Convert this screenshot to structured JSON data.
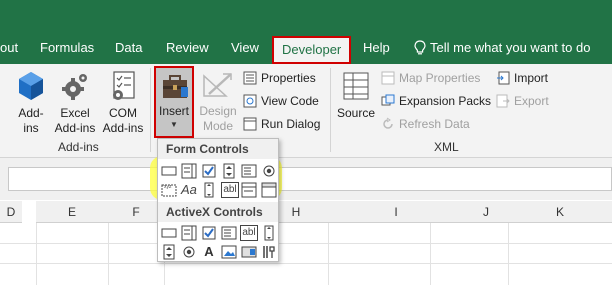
{
  "tabs": [
    {
      "label": "out"
    },
    {
      "label": "Formulas"
    },
    {
      "label": "Data"
    },
    {
      "label": "Review"
    },
    {
      "label": "View"
    },
    {
      "label": "Developer",
      "active": true
    },
    {
      "label": "Help"
    }
  ],
  "tell_me": "Tell me what you want to do",
  "ribbon": {
    "addins_group": {
      "label": "Add-ins",
      "buttons": [
        {
          "line1": "Add-",
          "line2": "ins",
          "icon": "addins-hexagon-icon"
        },
        {
          "line1": "Excel",
          "line2": "Add-ins",
          "icon": "gear-icon"
        },
        {
          "line1": "COM",
          "line2": "Add-ins",
          "icon": "checklist-icon"
        }
      ]
    },
    "controls_group": {
      "insert_label": "Insert",
      "design_mode": {
        "line1": "Design",
        "line2": "Mode"
      },
      "properties": "Properties",
      "view_code": "View Code",
      "run_dialog": "Run Dialog"
    },
    "xml_group": {
      "label": "XML",
      "source": "Source",
      "map_properties": "Map Properties",
      "expansion_packs": "Expansion Packs",
      "refresh_data": "Refresh Data",
      "import": "Import",
      "export": "Export"
    }
  },
  "insert_dropdown": {
    "form_controls_title": "Form Controls",
    "activex_controls_title": "ActiveX Controls",
    "text_aa": "Aa",
    "text_abl": "abl",
    "text_a": "A"
  },
  "columns": [
    "D",
    "E",
    "F",
    "G",
    "H",
    "I",
    "J",
    "K"
  ],
  "colors": {
    "excel_green": "#217346",
    "highlight_red": "#d00000",
    "marker_yellow": "#ffff3c"
  }
}
